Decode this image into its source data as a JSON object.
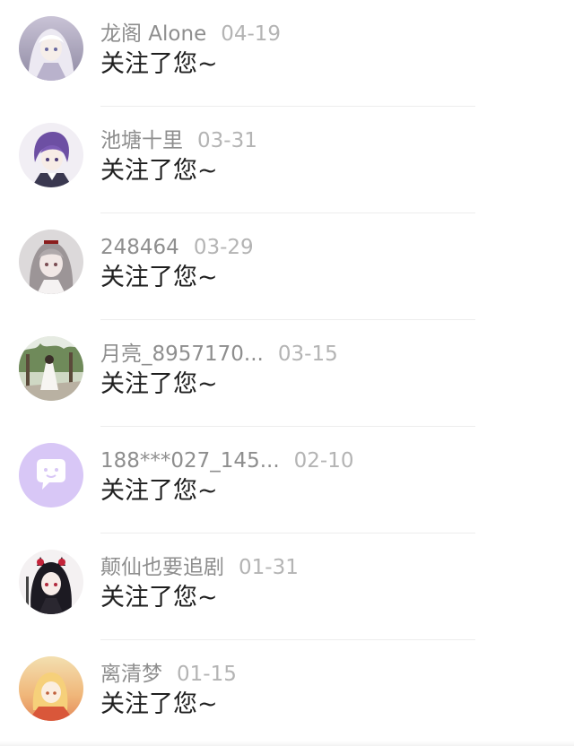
{
  "notifications": [
    {
      "name": "龙阁 Alone",
      "date": "04-19",
      "message": "关注了您~",
      "avatar": "anime-white-hair-avatar"
    },
    {
      "name": "池塘十里",
      "date": "03-31",
      "message": "关注了您~",
      "avatar": "anime-purple-hair-avatar"
    },
    {
      "name": "248464",
      "date": "03-29",
      "message": "关注了您~",
      "avatar": "anime-grey-hair-avatar"
    },
    {
      "name": "月亮_8957170...",
      "date": "03-15",
      "message": "关注了您~",
      "avatar": "outdoor-photo-avatar"
    },
    {
      "name": "188***027_145...",
      "date": "02-10",
      "message": "关注了您~",
      "avatar": "default-chat-bubble-avatar"
    },
    {
      "name": "颠仙也要追剧",
      "date": "01-31",
      "message": "关注了您~",
      "avatar": "anime-black-hair-avatar"
    },
    {
      "name": "离清梦",
      "date": "01-15",
      "message": "关注了您~",
      "avatar": "anime-sunset-avatar"
    }
  ],
  "colors": {
    "name_text": "#8e8e8e",
    "date_text": "#b4b4b4",
    "message_text": "#1f1f1f",
    "default_avatar_bg": "#d8c7f6"
  }
}
